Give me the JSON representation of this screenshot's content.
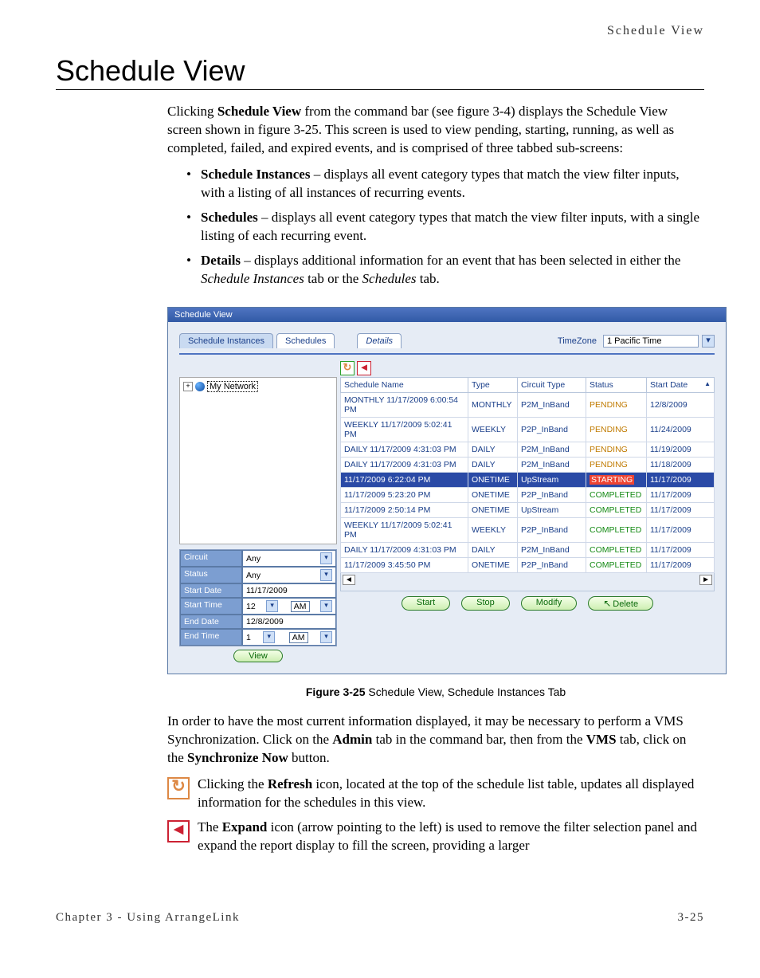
{
  "running_head": "Schedule View",
  "section_title": "Schedule View",
  "intro": "Clicking Schedule View from the command bar (see figure 3-4) displays the Schedule View screen shown in figure 3-25. This screen is used to view pending, starting, running, as well as completed, failed, and expired events, and is comprised of three tabbed sub-screens:",
  "bullets": [
    {
      "term": "Schedule Instances",
      "rest": " – displays all event category types that match the view filter inputs, with a listing of all instances of recurring events."
    },
    {
      "term": "Schedules",
      "rest": " – displays all event category types that match the view filter inputs, with a single listing of each recurring event."
    },
    {
      "term": "Details",
      "rest": " – displays additional information for an event that has been selected in either the Schedule Instances tab or the Schedules tab."
    }
  ],
  "app": {
    "title": "Schedule View",
    "tabs": {
      "instances": "Schedule Instances",
      "schedules": "Schedules",
      "details": "Details"
    },
    "timezone_label": "TimeZone",
    "timezone_value": "1 Pacific Time",
    "tree_root": "My Network",
    "filters": {
      "circuit_label": "Circuit",
      "circuit_value": "Any",
      "status_label": "Status",
      "status_value": "Any",
      "startdate_label": "Start Date",
      "startdate_value": "11/17/2009",
      "starttime_label": "Start Time",
      "starttime_value": "12",
      "starttime_ampm": "AM",
      "enddate_label": "End Date",
      "enddate_value": "12/8/2009",
      "endtime_label": "End Time",
      "endtime_value": "1",
      "endtime_ampm": "AM"
    },
    "view_btn": "View",
    "columns": {
      "name": "Schedule Name",
      "type": "Type",
      "circuit": "Circuit Type",
      "status": "Status",
      "start": "Start Date"
    },
    "rows": [
      {
        "name": "MONTHLY 11/17/2009 6:00:54 PM",
        "type": "MONTHLY",
        "circuit": "P2M_InBand",
        "status": "PENDING",
        "start": "12/8/2009 "
      },
      {
        "name": "WEEKLY 11/17/2009 5:02:41 PM",
        "type": "WEEKLY",
        "circuit": "P2P_InBand",
        "status": "PENDING",
        "start": "11/24/2009"
      },
      {
        "name": "DAILY 11/17/2009 4:31:03 PM",
        "type": "DAILY",
        "circuit": "P2M_InBand",
        "status": "PENDING",
        "start": "11/19/2009"
      },
      {
        "name": "DAILY 11/17/2009 4:31:03 PM",
        "type": "DAILY",
        "circuit": "P2M_InBand",
        "status": "PENDING",
        "start": "11/18/2009"
      },
      {
        "name": "11/17/2009 6:22:04 PM",
        "type": "ONETIME",
        "circuit": "UpStream",
        "status": "STARTING",
        "start": "11/17/2009"
      },
      {
        "name": "11/17/2009 5:23:20 PM",
        "type": "ONETIME",
        "circuit": "P2P_InBand",
        "status": "COMPLETED",
        "start": "11/17/2009"
      },
      {
        "name": "11/17/2009 2:50:14 PM",
        "type": "ONETIME",
        "circuit": "UpStream",
        "status": "COMPLETED",
        "start": "11/17/2009"
      },
      {
        "name": "WEEKLY 11/17/2009 5:02:41 PM",
        "type": "WEEKLY",
        "circuit": "P2P_InBand",
        "status": "COMPLETED",
        "start": "11/17/2009"
      },
      {
        "name": "DAILY 11/17/2009 4:31:03 PM",
        "type": "DAILY",
        "circuit": "P2M_InBand",
        "status": "COMPLETED",
        "start": "11/17/2009"
      },
      {
        "name": "11/17/2009 3:45:50 PM",
        "type": "ONETIME",
        "circuit": "P2P_InBand",
        "status": "COMPLETED",
        "start": "11/17/2009"
      }
    ],
    "actions": {
      "start": "Start",
      "stop": "Stop",
      "modify": "Modify",
      "delete": "Delete"
    }
  },
  "figure_caption_bold": "Figure 3-25",
  "figure_caption_rest": "   Schedule View, Schedule Instances Tab",
  "para_sync": "In order to have the most current information displayed, it may be necessary to perform a VMS Synchronization. Click on the Admin tab in the command bar, then from the VMS tab, click on the Synchronize Now button.",
  "para_refresh": "Clicking the Refresh icon, located at the top of the schedule list table, updates all displayed information for the schedules in this view.",
  "para_expand": "The Expand icon (arrow pointing to the left) is used to remove the filter selection panel and expand the report display to fill the screen, providing a larger",
  "footer_left": "Chapter 3 - Using ArrangeLink",
  "footer_right": "3-25"
}
